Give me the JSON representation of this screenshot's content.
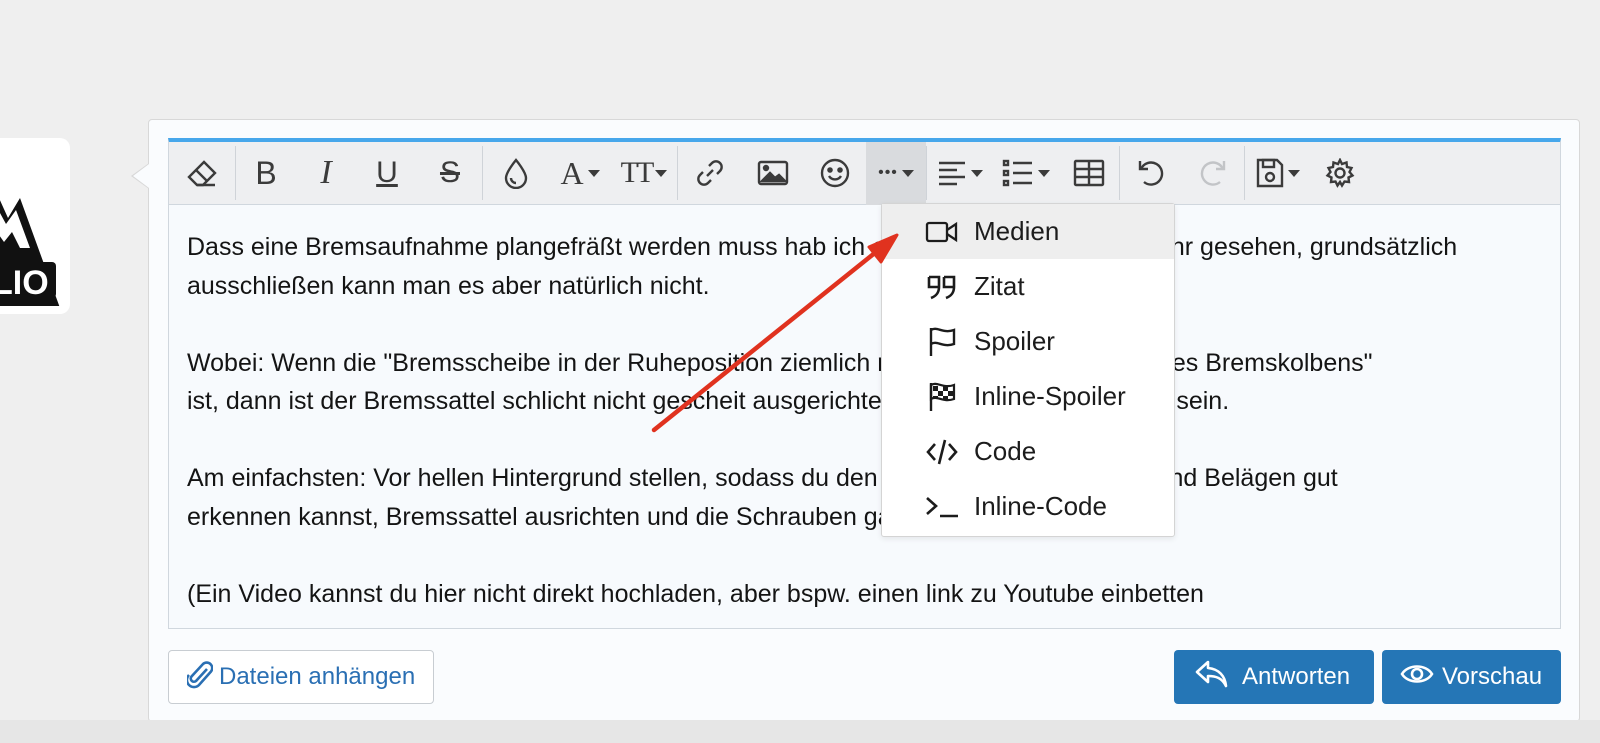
{
  "editor": {
    "paragraphs": [
      [
        "Dass eine Bremsaufnahme plangefräßt werden muss hab ich ehrlich gesagt noch nie mehr gesehen, grundsätzlich",
        "ausschließen kann man es aber natürlich nicht."
      ],
      [
        "Wobei: Wenn die \"Bremsscheibe in der Ruheposition ziemlich nah an der inneren Seite des Bremskolbens\"",
        "ist, dann ist der Bremssattel schlicht nicht gescheit ausgerichtet. Die Scheibe sollte mittig sein."
      ],
      [
        "Am einfachsten: Vor hellen Hintergrund stellen, sodass du den Spalt zwischen Scheibe und Belägen gut",
        "erkennen kannst, Bremssattel ausrichten und die Schrauben ganz vorsichtig anziehen."
      ],
      [
        "(Ein Video kannst du hier nicht direkt hochladen, aber bspw. einen link zu Youtube einbetten"
      ]
    ]
  },
  "toolbar": {
    "buttons": [
      {
        "name": "remove-format",
        "icon": "eraser-icon"
      },
      {
        "name": "bold",
        "icon": "bold-icon",
        "glyph": "B"
      },
      {
        "name": "italic",
        "icon": "italic-icon",
        "glyph": "I"
      },
      {
        "name": "underline",
        "icon": "underline-icon",
        "glyph": "U"
      },
      {
        "name": "strikethrough",
        "icon": "strikethrough-icon",
        "glyph": "S"
      },
      {
        "name": "text-color",
        "icon": "droplet-icon"
      },
      {
        "name": "font-family",
        "icon": "font-icon",
        "glyph": "A"
      },
      {
        "name": "font-size",
        "icon": "text-size-icon",
        "glyph": "TT"
      },
      {
        "name": "link",
        "icon": "link-icon"
      },
      {
        "name": "image",
        "icon": "image-icon"
      },
      {
        "name": "smilies",
        "icon": "smiley-icon"
      },
      {
        "name": "more",
        "icon": "ellipsis-icon",
        "glyph": "•••"
      },
      {
        "name": "align",
        "icon": "align-left-icon"
      },
      {
        "name": "list",
        "icon": "list-icon"
      },
      {
        "name": "table",
        "icon": "table-icon"
      },
      {
        "name": "undo",
        "icon": "undo-icon"
      },
      {
        "name": "redo",
        "icon": "redo-icon"
      },
      {
        "name": "drafts",
        "icon": "save-icon"
      },
      {
        "name": "settings",
        "icon": "gear-icon"
      }
    ]
  },
  "dropdown": {
    "items": [
      {
        "label": "Medien",
        "icon": "video-camera-icon",
        "hover": true
      },
      {
        "label": "Zitat",
        "icon": "quote-icon"
      },
      {
        "label": "Spoiler",
        "icon": "flag-icon"
      },
      {
        "label": "Inline-Spoiler",
        "icon": "checkered-flag-icon"
      },
      {
        "label": "Code",
        "icon": "code-icon"
      },
      {
        "label": "Inline-Code",
        "icon": "terminal-icon"
      }
    ]
  },
  "footer": {
    "attach_label": "Dateien anhängen",
    "reply_label": "Antworten",
    "preview_label": "Vorschau"
  },
  "colors": {
    "accent": "#47a7eb",
    "button_primary": "#2576b6",
    "link": "#2a6fb3",
    "annotation_arrow": "#e0321f"
  }
}
